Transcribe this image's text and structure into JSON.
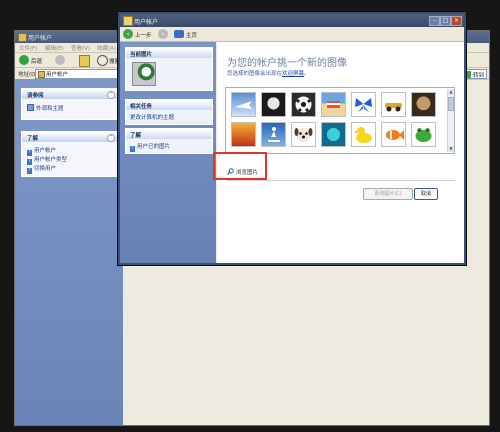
{
  "background_window": {
    "title": "用户帐户",
    "menu": [
      "文件(F)",
      "编辑(E)",
      "查看(V)",
      "收藏(A)"
    ],
    "toolbar": {
      "back": "后退",
      "search": "搜索"
    },
    "address_label": "地址(D)",
    "address_value": "用户帐户",
    "go_label": "转到",
    "see_also": {
      "title": "请参阅",
      "items": [
        "外观和主题"
      ]
    },
    "learn": {
      "title": "了解",
      "items": [
        "用户帐户",
        "用户帐户类型",
        "切换用户"
      ]
    }
  },
  "dialog": {
    "title": "用户帐户",
    "nav": {
      "back": "上一步",
      "home": "主页"
    },
    "sidebar": {
      "current_picture": "当前图片",
      "related": {
        "title": "相关任务",
        "items": [
          "更改计算机的主题"
        ]
      },
      "learn": {
        "title": "了解",
        "items": [
          "用户已的图片"
        ]
      }
    },
    "main": {
      "heading": "为您的帐户挑一个新的图像",
      "subtitle_prefix": "您选择的图像会出现在",
      "subtitle_link": "欢迎屏幕",
      "subtitle_suffix": "。",
      "pictures": [
        "airplane",
        "astronaut",
        "soccer-ball",
        "beach-chair",
        "butterfly",
        "car",
        "dog",
        "fire",
        "skateboarder",
        "puppy",
        "drip",
        "rubber-duck",
        "fish",
        "frog"
      ],
      "browse_label": "浏览图片",
      "change_button": "更改图片(C)",
      "cancel_button": "取消"
    }
  },
  "colors": {
    "highlight": "#e5322f",
    "heading": "#6b7ea8",
    "sidebar": "#7b95c6"
  }
}
